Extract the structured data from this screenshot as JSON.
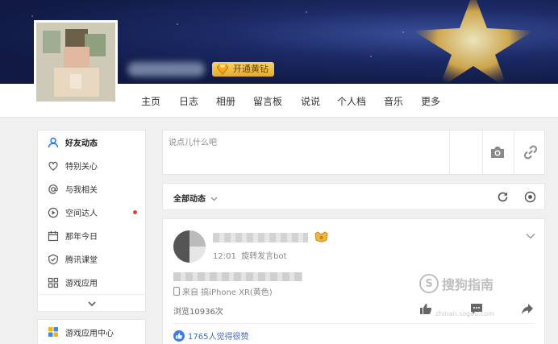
{
  "profile": {
    "vip_label": "开通黄钻"
  },
  "nav": {
    "items": [
      {
        "label": "主页"
      },
      {
        "label": "日志"
      },
      {
        "label": "相册"
      },
      {
        "label": "留言板"
      },
      {
        "label": "说说"
      },
      {
        "label": "个人档"
      },
      {
        "label": "音乐"
      },
      {
        "label": "更多"
      }
    ]
  },
  "sidebar": {
    "items": [
      {
        "label": "好友动态",
        "icon": "user-icon",
        "active": true
      },
      {
        "label": "特别关心",
        "icon": "heart-icon"
      },
      {
        "label": "与我相关",
        "icon": "at-icon"
      },
      {
        "label": "空间达人",
        "icon": "play-circle-icon",
        "badge_dot": true
      },
      {
        "label": "那年今日",
        "icon": "calendar-icon"
      },
      {
        "label": "腾讯课堂",
        "icon": "shield-icon"
      },
      {
        "label": "游戏应用",
        "icon": "grid-icon"
      }
    ],
    "bottom_item": {
      "label": "游戏应用中心",
      "icon": "game-center-icon"
    }
  },
  "composer": {
    "placeholder": "说点儿什么吧"
  },
  "feed_filter": {
    "label": "全部动态"
  },
  "post": {
    "time": "12:01",
    "via": "旋转发言bot",
    "source": "来自 搞iPhone XR(黄色)",
    "views": "浏览10936次",
    "likes": "1765人觉得很赞"
  },
  "watermark": {
    "text": "搜狗指南",
    "sub": "zhinan.sogou.com"
  },
  "colors": {
    "accent": "#1e6fdc",
    "vip": "#f0b640",
    "banner": "#1c2a66"
  }
}
